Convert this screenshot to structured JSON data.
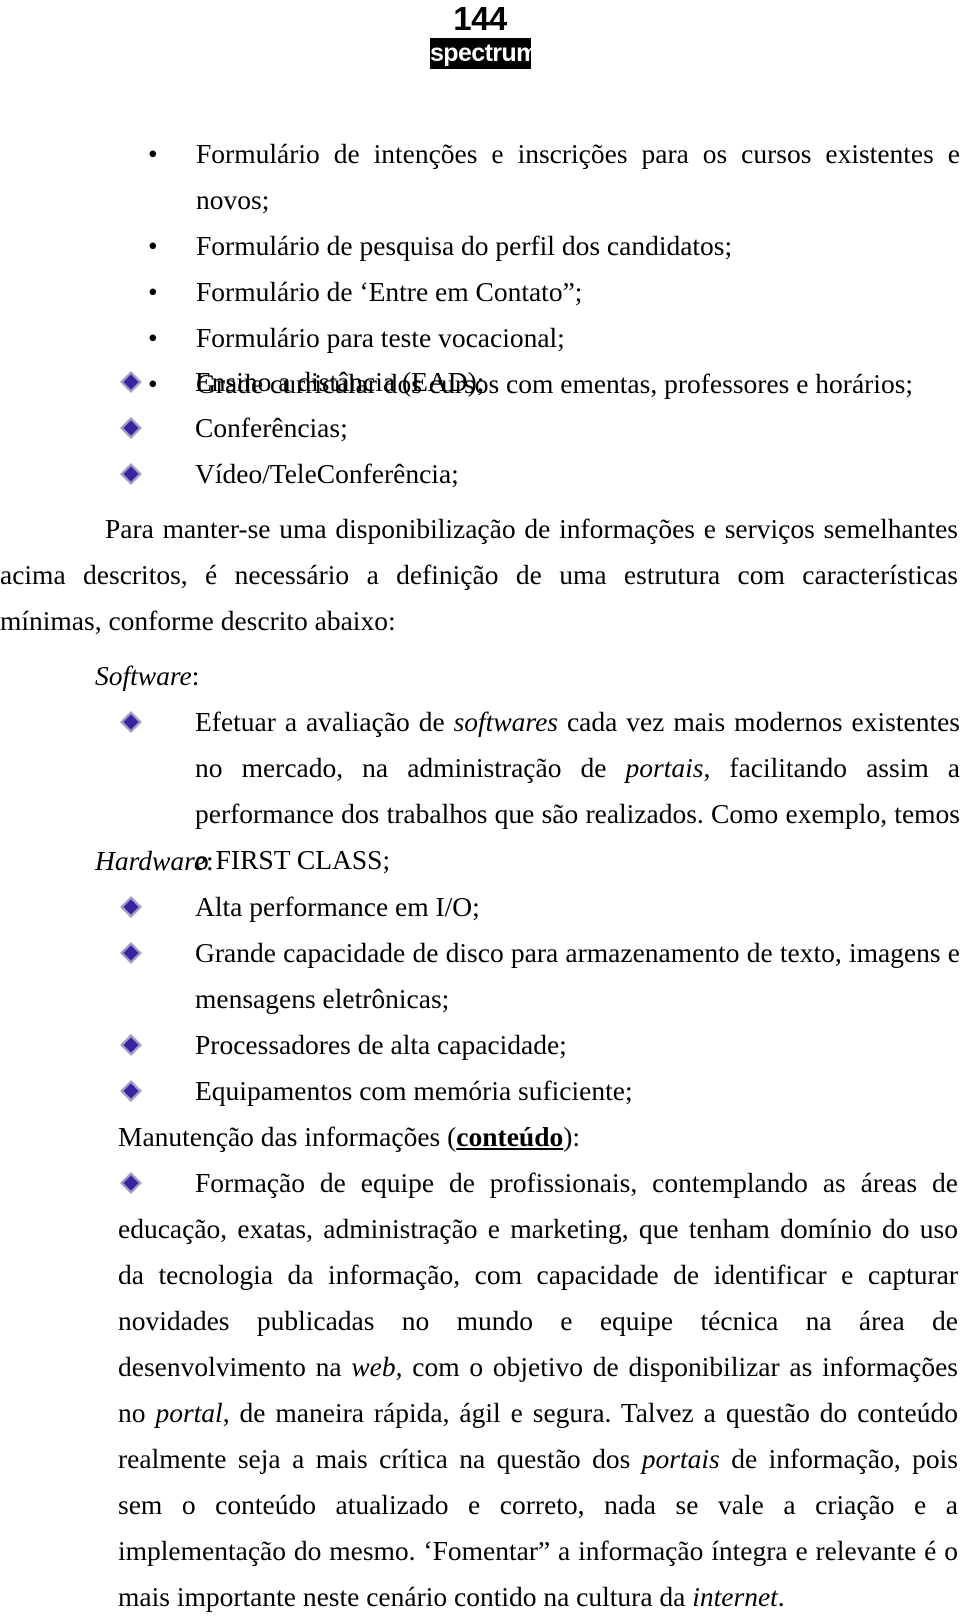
{
  "header": {
    "folio": "144",
    "logo": "spectrum"
  },
  "colors": {
    "diamond_fill": "#3A22A0",
    "diamond_edge": "#9D9DC4",
    "text": "#000000",
    "logo_bg": "#000000",
    "logo_fg": "#ffffff"
  },
  "round_bullets": {
    "marker": "•",
    "items": [
      "Formulário de intenções e inscrições para os cursos existentes e novos;",
      "Formulário de pesquisa do perfil dos candidatos;",
      "Formulário de ‘Entre em Contato”;",
      "Formulário para teste vocacional;",
      "Grade curricular dos cursos com ementas, professores e horários;"
    ]
  },
  "diamond_bullets_top": {
    "items": [
      "Ensino a distância (EAD);",
      "Conferências;",
      "Vídeo/TeleConferência;"
    ]
  },
  "intro_paragraph": {
    "text": "Para manter-se uma disponibilização de informações e serviços semelhantes acima descritos, é necessário a definição de uma estrutura com características mínimas, conforme descrito abaixo:"
  },
  "software_section": {
    "heading": "Software",
    "heading_suffix": ":",
    "item_part1": "Efetuar a avaliação de ",
    "item_italic1": "softwares",
    "item_part2": " cada vez mais modernos existentes no mercado, na administração de ",
    "item_italic2": "portais",
    "item_part3": ", facilitando assim a performance dos trabalhos que são realizados.  Como exemplo, temos o FIRST CLASS;"
  },
  "hardware_section": {
    "heading": "Hardware",
    "heading_suffix": ":",
    "items": [
      "Alta performance em I/O;",
      "Grande capacidade de disco para armazenamento de texto, imagens e mensagens eletrônicas;",
      "Processadores de alta capacidade;",
      "Equipamentos com memória suficiente;"
    ]
  },
  "maintenance_section": {
    "heading_part1": "Manutenção das informações (",
    "heading_emph": "conteúdo",
    "heading_part2": "):",
    "p1": "Formação de equipe de profissionais, contemplando as áreas de educação, exatas, administração e marketing, que tenham domínio do uso da tecnologia da informação, com capacidade de identificar e capturar novidades publicadas no mundo e equipe técnica na área de desenvolvimento na ",
    "i1": "web,",
    "p2": "  com o objetivo de disponibilizar as informações no ",
    "i2": "portal",
    "p3": ", de maneira rápida, ágil e segura.  Talvez a questão do conteúdo realmente seja a mais crítica na questão dos ",
    "i3": "portais",
    "p4": " de informação, pois sem o conteúdo atualizado e correto, nada se vale a criação e a implementação do mesmo. ‘Fomentar” a informação íntegra e relevante é o mais importante neste cenário contido na cultura da ",
    "i4": "internet",
    "p5": "."
  }
}
